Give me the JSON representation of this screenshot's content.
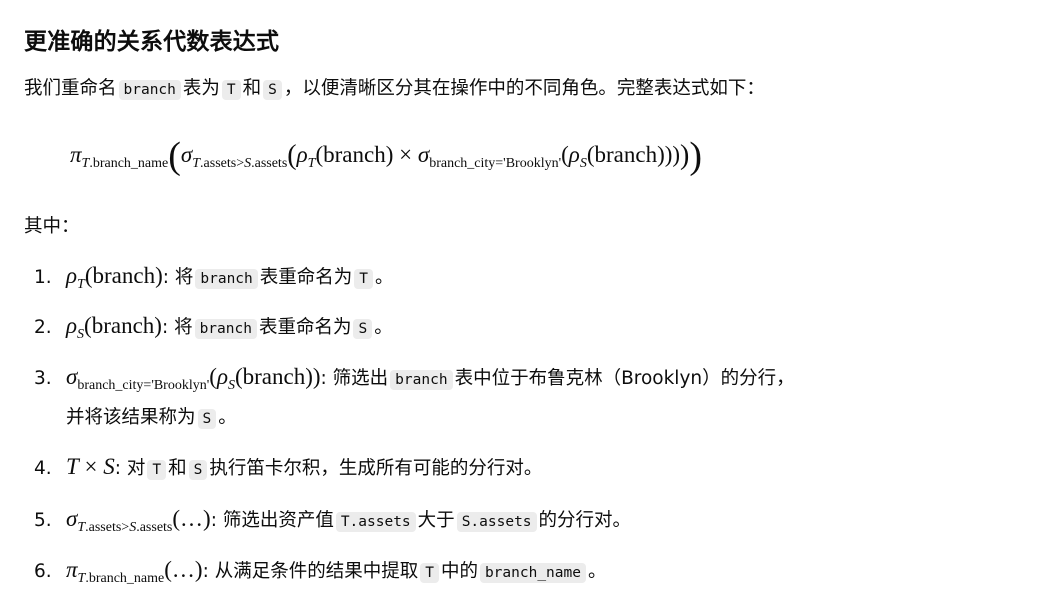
{
  "heading": "更准确的关系代数表达式",
  "intro": {
    "p1": "我们重命名",
    "c1": "branch",
    "p2": "表为",
    "c2": "T",
    "p3": "和",
    "c3": "S",
    "p4": "，以便清晰区分其在操作中的不同角色。完整表达式如下："
  },
  "formula": {
    "pi": "π",
    "pi_sub_var": "T",
    "pi_sub_rest": ".branch_name",
    "sigma": "σ",
    "sigma_sub_a": "T",
    "sigma_sub_b": ".assets>",
    "sigma_sub_c": "S",
    "sigma_sub_d": ".assets",
    "rho": "ρ",
    "rho_t_sub": "T",
    "branch1": "(branch)",
    "times": "×",
    "sigma2": "σ",
    "sigma2_sub": "branch_city='Brooklyn'",
    "rho2": "ρ",
    "rho_s_sub": "S",
    "branch2": "(branch)))"
  },
  "where": "其中：",
  "items": [
    {
      "num": "1.",
      "sym": "ρ",
      "sub": "T",
      "arg": "(branch)",
      "t1": ": 将",
      "c1": "branch",
      "t2": "表重命名为",
      "c2": "T",
      "t3": "。"
    },
    {
      "num": "2.",
      "sym": "ρ",
      "sub": "S",
      "arg": "(branch)",
      "t1": ": 将",
      "c1": "branch",
      "t2": "表重命名为",
      "c2": "S",
      "t3": "。"
    },
    {
      "num": "3.",
      "sym": "σ",
      "sub": "branch_city='Brooklyn'",
      "arg_open": "(",
      "inner_sym": "ρ",
      "inner_sub": "S",
      "arg": "(branch))",
      "t1": ": 筛选出",
      "c1": "branch",
      "t2": "表中位于布鲁克林（Brooklyn）的分行，",
      "cont1": "并将该结果称为",
      "c2": "S",
      "t3": "。"
    },
    {
      "num": "4.",
      "a": "T",
      "x": "×",
      "b": "S",
      "t1": ": 对",
      "c1": "T",
      "t2": "和",
      "c2": "S",
      "t3": "执行笛卡尔积，生成所有可能的分行对。"
    },
    {
      "num": "5.",
      "sym": "σ",
      "sub_a": "T",
      "sub_b": ".assets>",
      "sub_c": "S",
      "sub_d": ".assets",
      "arg": "(…)",
      "t1": ": 筛选出资产值",
      "c1": "T.assets",
      "t2": "大于",
      "c2": "S.assets",
      "t3": "的分行对。"
    },
    {
      "num": "6.",
      "sym": "π",
      "sub_a": "T",
      "sub_b": ".branch_name",
      "arg": "(…)",
      "t1": ": 从满足条件的结果中提取",
      "c1": "T",
      "t2": "中的",
      "c2": "branch_name",
      "t3": "。"
    }
  ]
}
